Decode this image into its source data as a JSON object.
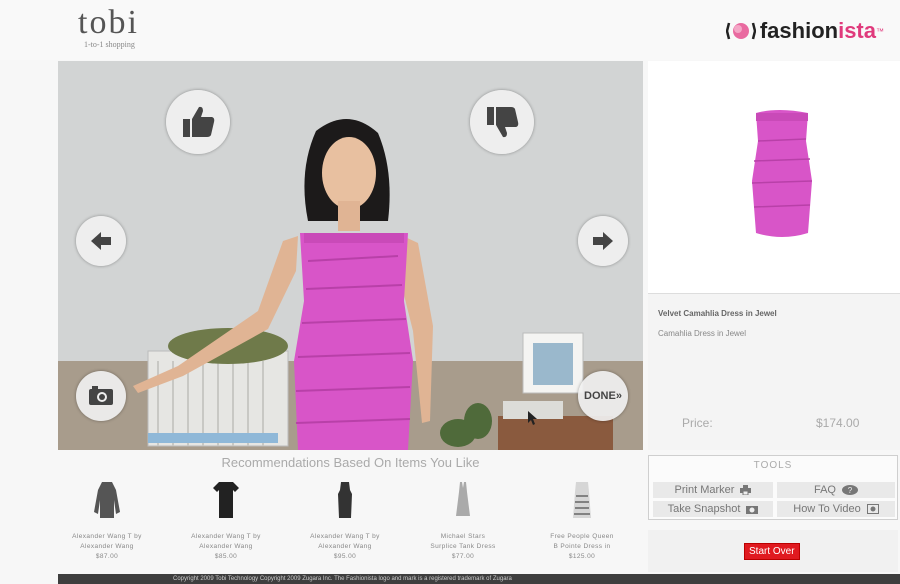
{
  "header": {
    "left_logo": {
      "word": "tobi",
      "tagline": "1-to-1 shopping"
    },
    "right_logo": {
      "word_part1": "fashion",
      "word_part2": "ista",
      "tm": "™"
    }
  },
  "video": {
    "like_icon": "thumbs-up-icon",
    "dislike_icon": "thumbs-down-icon",
    "prev_icon": "arrow-left-icon",
    "next_icon": "arrow-right-icon",
    "camera_icon": "camera-icon",
    "done_label": "DONE»"
  },
  "product": {
    "name": "Velvet Camahlia Dress in Jewel",
    "subtitle": "Camahlia Dress in Jewel",
    "price_label": "Price:",
    "price_value": "$174.00",
    "color": "#d855c8"
  },
  "recommendations": {
    "title": "Recommendations Based On Items You Like",
    "items": [
      {
        "line1": "Alexander Wang T by",
        "line2": "Alexander Wang",
        "price": "$87.00",
        "color": "#555555"
      },
      {
        "line1": "Alexander Wang T by",
        "line2": "Alexander Wang",
        "price": "$85.00",
        "color": "#222222"
      },
      {
        "line1": "Alexander Wang T by",
        "line2": "Alexander Wang",
        "price": "$95.00",
        "color": "#333333"
      },
      {
        "line1": "Michael Stars",
        "line2": "Surplice Tank Dress",
        "price": "$77.00",
        "color": "#aaaaaa"
      },
      {
        "line1": "Free People Queen",
        "line2": "B Pointe Dress in",
        "price": "$125.00",
        "color": "#cccccc"
      }
    ]
  },
  "tools": {
    "title": "TOOLS",
    "print_marker": "Print Marker",
    "faq": "FAQ",
    "take_snapshot": "Take Snapshot",
    "how_to_video": "How To Video"
  },
  "start_over": "Start Over",
  "footer": "Copyright 2009 Tobi Technology    Copyright 2009 Zugara Inc.    The Fashionista logo and mark is a registered trademark of Zugara"
}
